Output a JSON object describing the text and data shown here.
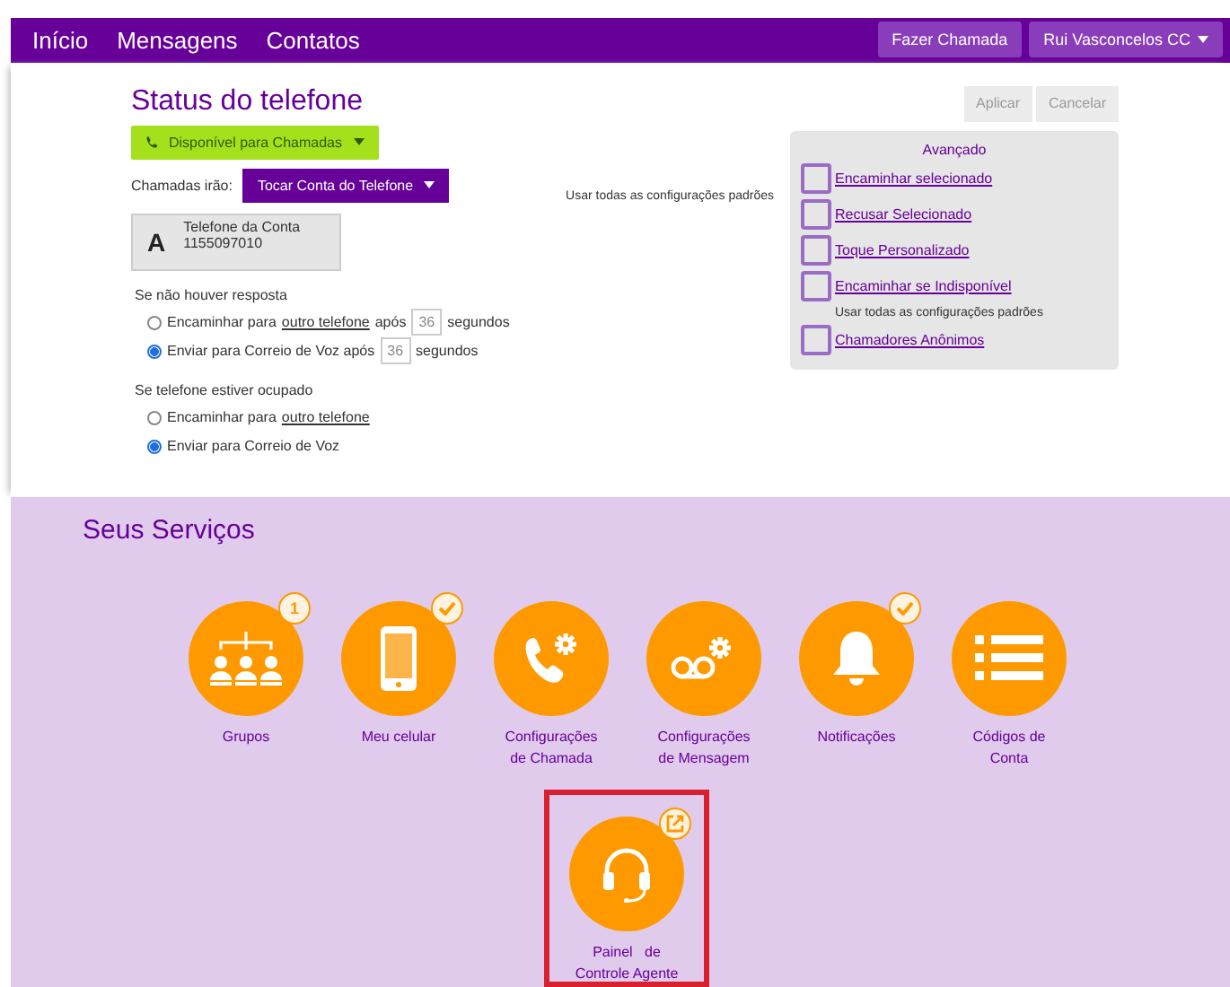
{
  "nav": {
    "links": [
      {
        "label": "Início"
      },
      {
        "label": "Mensagens"
      },
      {
        "label": "Contatos"
      }
    ],
    "call_button": "Fazer Chamada",
    "user_menu": "Rui Vasconcelos CC"
  },
  "phone_status": {
    "title": "Status do telefone",
    "status_button": "Disponível para Chamadas",
    "calls_label": "Chamadas irão:",
    "calls_dropdown": "Tocar Conta do Telefone",
    "defaults_note": "Usar todas as configurações padrões",
    "account": {
      "letter": "A",
      "name": "Telefone da Conta",
      "number": "1155097010"
    },
    "groups": [
      {
        "title": "Se não houver resposta",
        "options": [
          {
            "selected": false,
            "parts": [
              {
                "kind": "text",
                "text": "Encaminhar para"
              },
              {
                "kind": "link",
                "text": "outro telefone"
              },
              {
                "kind": "text",
                "text": "após"
              },
              {
                "kind": "input",
                "text": "36"
              },
              {
                "kind": "text",
                "text": "segundos"
              }
            ]
          },
          {
            "selected": true,
            "parts": [
              {
                "kind": "text",
                "text": "Enviar para Correio de Voz após"
              },
              {
                "kind": "input",
                "text": "36"
              },
              {
                "kind": "text",
                "text": "segundos"
              }
            ]
          }
        ]
      },
      {
        "title": "Se telefone estiver ocupado",
        "options": [
          {
            "selected": false,
            "parts": [
              {
                "kind": "text",
                "text": "Encaminhar para"
              },
              {
                "kind": "link",
                "text": "outro telefone"
              }
            ]
          },
          {
            "selected": true,
            "parts": [
              {
                "kind": "text",
                "text": "Enviar para Correio de Voz"
              }
            ]
          }
        ]
      }
    ],
    "apply_button": {
      "label": "Aplicar",
      "disabled": true
    },
    "cancel_button": {
      "label": "Cancelar",
      "disabled": true
    },
    "advanced": {
      "title": "Avançado",
      "items": [
        {
          "kind": "check",
          "label": "Encaminhar selecionado",
          "checked": false
        },
        {
          "kind": "check",
          "label": "Recusar Selecionado",
          "checked": false
        },
        {
          "kind": "check",
          "label": "Toque Personalizado",
          "checked": false
        },
        {
          "kind": "check",
          "label": "Encaminhar se Indisponível",
          "checked": false
        },
        {
          "kind": "note",
          "label": "Usar todas as configurações padrões"
        },
        {
          "kind": "check",
          "label": "Chamadores Anônimos",
          "checked": false
        }
      ]
    }
  },
  "services": {
    "title": "Seus Serviços",
    "items": [
      {
        "kind": "groups",
        "lines": [
          "Grupos"
        ],
        "badge": {
          "kind": "count",
          "text": "1"
        },
        "highlighted": false
      },
      {
        "kind": "phone",
        "lines": [
          "Meu celular"
        ],
        "badge": {
          "kind": "check"
        },
        "highlighted": false
      },
      {
        "kind": "callsettings",
        "lines": [
          "Configurações",
          "de Chamada"
        ],
        "highlighted": false
      },
      {
        "kind": "voicemail",
        "lines": [
          "Configurações",
          "de Mensagem"
        ],
        "highlighted": false
      },
      {
        "kind": "bell",
        "lines": [
          "Notificações"
        ],
        "badge": {
          "kind": "check"
        },
        "highlighted": false
      },
      {
        "kind": "list",
        "lines": [
          "Códigos de",
          "Conta"
        ],
        "highlighted": false
      },
      {
        "kind": "headset",
        "lines": [
          "Painel   de",
          "Controle Agente"
        ],
        "badge": {
          "kind": "external"
        },
        "highlighted": true
      }
    ]
  }
}
